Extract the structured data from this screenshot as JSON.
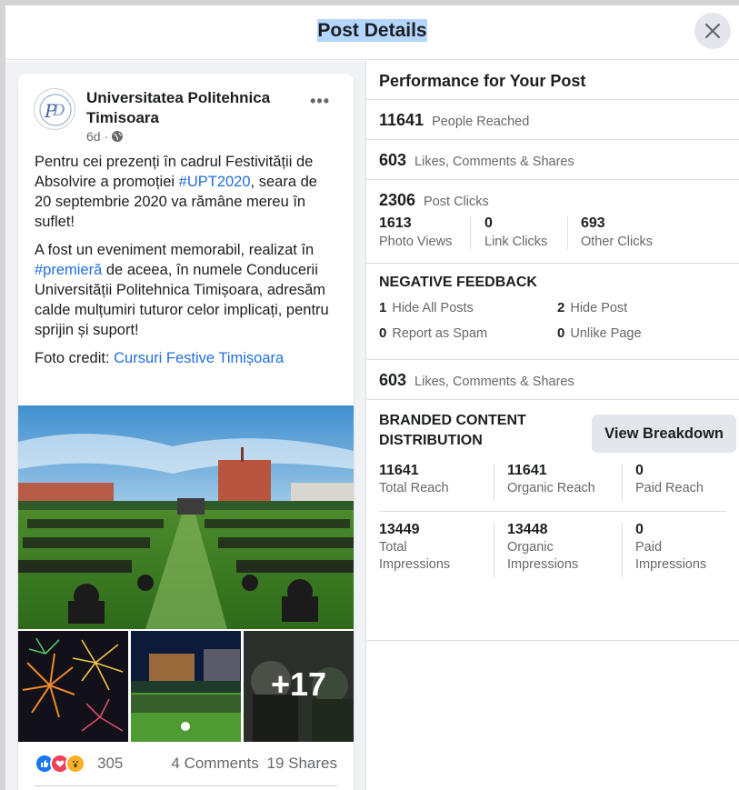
{
  "dialog": {
    "title": "Post Details"
  },
  "post": {
    "author": "Universitatea Politehnica Timisoara",
    "age": "6d ·",
    "paragraph1_pre": "Pentru cei prezenți în cadrul Festivității de Absolvire a promoției ",
    "paragraph1_tag": "#UPT2020",
    "paragraph1_post": ", seara de 20 septembrie 2020 va rămâne mereu în suflet!",
    "paragraph2_pre": "A fost un eveniment memorabil, realizat în ",
    "paragraph2_tag": "#premieră",
    "paragraph2_post": " de aceea, în numele Conducerii Universității Politehnica Timișoara, adresăm calde mulțumiri tuturor celor implicați, pentru sprijin și suport!",
    "credit_label": "Foto credit: ",
    "credit_link": "Cursuri Festive Timișoara",
    "more_photos": "+17",
    "reaction_count": "305",
    "comments": "4 Comments",
    "shares": "19 Shares"
  },
  "performance": {
    "title": "Performance for Your Post",
    "people_reached": {
      "value": "11641",
      "label": "People Reached"
    },
    "engagement": {
      "value": "603",
      "label": "Likes, Comments & Shares"
    },
    "post_clicks": {
      "value": "2306",
      "label": "Post Clicks"
    },
    "click_breakdown": [
      {
        "value": "1613",
        "label": "Photo Views"
      },
      {
        "value": "0",
        "label": "Link Clicks"
      },
      {
        "value": "693",
        "label": "Other Clicks"
      }
    ],
    "negative_feedback": {
      "title": "NEGATIVE FEEDBACK",
      "items": [
        {
          "value": "1",
          "label": "Hide All Posts"
        },
        {
          "value": "2",
          "label": "Hide Post"
        },
        {
          "value": "0",
          "label": "Report as Spam"
        },
        {
          "value": "0",
          "label": "Unlike Page"
        }
      ]
    },
    "engagement2": {
      "value": "603",
      "label": "Likes, Comments & Shares"
    },
    "branded": {
      "title": "BRANDED CONTENT DISTRIBUTION",
      "button": "View Breakdown",
      "reach": [
        {
          "value": "11641",
          "label": "Total Reach"
        },
        {
          "value": "11641",
          "label": "Organic Reach"
        },
        {
          "value": "0",
          "label": "Paid Reach"
        }
      ],
      "impressions": [
        {
          "value": "13449",
          "label": "Total Impressions"
        },
        {
          "value": "13448",
          "label": "Organic Impressions"
        },
        {
          "value": "0",
          "label": "Paid Impressions"
        }
      ]
    }
  },
  "colors": {
    "link": "#216fdb",
    "like": "#1877f2",
    "love": "#f33e58",
    "wow": "#f7b125"
  }
}
